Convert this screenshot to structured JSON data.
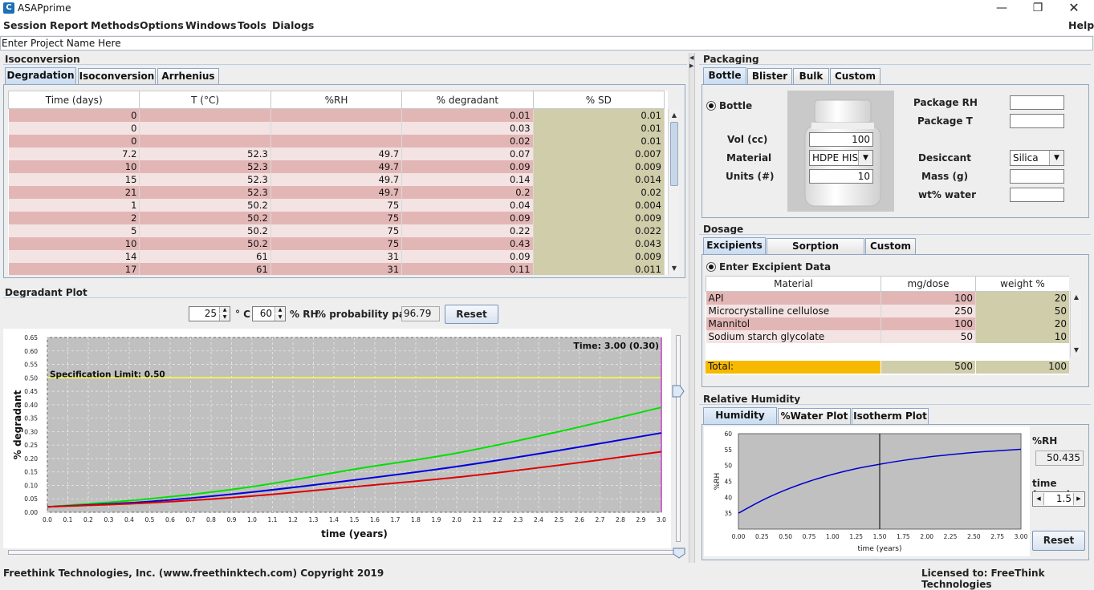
{
  "window": {
    "title": "ASAPprime",
    "icon": "app-icon"
  },
  "menu": [
    "Session",
    "Report",
    "Methods",
    "Options",
    "Windows",
    "Tools",
    "Dialogs"
  ],
  "menu_help": "Help",
  "project_name_placeholder": "Enter Project Name Here",
  "isoconversion": {
    "title": "Isoconversion",
    "tabs": [
      "Degradation",
      "Isoconversion",
      "Arrhenius"
    ],
    "columns": [
      "Time (days)",
      "T (°C)",
      "%RH",
      "% degradant",
      "% SD"
    ],
    "rows": [
      [
        "0",
        "",
        "",
        "0.01",
        "0.01"
      ],
      [
        "0",
        "",
        "",
        "0.03",
        "0.01"
      ],
      [
        "0",
        "",
        "",
        "0.02",
        "0.01"
      ],
      [
        "7.2",
        "52.3",
        "49.7",
        "0.07",
        "0.007"
      ],
      [
        "10",
        "52.3",
        "49.7",
        "0.09",
        "0.009"
      ],
      [
        "15",
        "52.3",
        "49.7",
        "0.14",
        "0.014"
      ],
      [
        "21",
        "52.3",
        "49.7",
        "0.2",
        "0.02"
      ],
      [
        "1",
        "50.2",
        "75",
        "0.04",
        "0.004"
      ],
      [
        "2",
        "50.2",
        "75",
        "0.09",
        "0.009"
      ],
      [
        "5",
        "50.2",
        "75",
        "0.22",
        "0.022"
      ],
      [
        "10",
        "50.2",
        "75",
        "0.43",
        "0.043"
      ],
      [
        "14",
        "61",
        "31",
        "0.09",
        "0.009"
      ],
      [
        "17",
        "61",
        "31",
        "0.11",
        "0.011"
      ]
    ]
  },
  "degradant_plot": {
    "title": "Degradant Plot",
    "temp_value": "25",
    "temp_unit": "° C",
    "rh_value": "60",
    "rh_unit": "% RH",
    "prob_label": "% probability pass",
    "prob_value": "96.79",
    "reset_label": "Reset"
  },
  "packaging": {
    "title": "Packaging",
    "tabs": [
      "Bottle",
      "Blister",
      "Bulk",
      "Custom"
    ],
    "radio_label": "Bottle",
    "vol_label": "Vol (cc)",
    "vol_value": "100",
    "material_label": "Material",
    "material_value": "HDPE HIS",
    "units_label": "Units (#)",
    "units_value": "10",
    "package_rh_label": "Package RH",
    "package_t_label": "Package T",
    "desiccant_label": "Desiccant",
    "desiccant_value": "Silica",
    "mass_label": "Mass (g)",
    "wt_water_label": "wt% water"
  },
  "dosage": {
    "title": "Dosage",
    "tabs": [
      "Excipients",
      "Sorption Isotherm",
      "Custom"
    ],
    "radio_label": "Enter Excipient Data",
    "columns": [
      "Material",
      "mg/dose",
      "weight %"
    ],
    "rows": [
      [
        "API",
        "100",
        "20"
      ],
      [
        "Microcrystalline cellulose",
        "250",
        "50"
      ],
      [
        "Mannitol",
        "100",
        "20"
      ],
      [
        "Sodium starch glycolate",
        "50",
        "10"
      ]
    ],
    "total_label": "Total:",
    "total_mg": "500",
    "total_pct": "100"
  },
  "relative_humidity": {
    "title": "Relative Humidity",
    "tabs": [
      "Humidity Plot",
      "%Water Plot",
      "Isotherm Plot"
    ],
    "rh_label": "%RH",
    "rh_value": "50.435",
    "time_label": "time (years)",
    "time_value": "1.5",
    "reset_label": "Reset"
  },
  "footer": {
    "left": "Freethink Technologies, Inc. (www.freethinktech.com) Copyright 2019",
    "right": "Licensed to: FreeThink Technologies"
  },
  "chart_data": [
    {
      "type": "line",
      "title": "",
      "xlabel": "time (years)",
      "ylabel": "% degradant",
      "xlim": [
        0,
        3.0
      ],
      "ylim": [
        0,
        0.65
      ],
      "x_ticks": [
        "0.0",
        "0.1",
        "0.2",
        "0.3",
        "0.4",
        "0.5",
        "0.6",
        "0.7",
        "0.8",
        "0.9",
        "1.0",
        "1.1",
        "1.2",
        "1.3",
        "1.4",
        "1.5",
        "1.6",
        "1.7",
        "1.8",
        "1.9",
        "2.0",
        "2.1",
        "2.2",
        "2.3",
        "2.4",
        "2.5",
        "2.6",
        "2.7",
        "2.8",
        "2.9",
        "3.0"
      ],
      "y_ticks": [
        "0.00",
        "0.05",
        "0.10",
        "0.15",
        "0.20",
        "0.25",
        "0.30",
        "0.35",
        "0.40",
        "0.45",
        "0.50",
        "0.55",
        "0.60",
        "0.65"
      ],
      "annotations": [
        "Time: 3.00 (0.30)",
        "Specification Limit: 0.50"
      ],
      "spec_limit": 0.5,
      "grid": true,
      "background": "#c0c0c0",
      "series": [
        {
          "color": "#00e000",
          "x": [
            0,
            0.5,
            1.0,
            1.5,
            2.0,
            2.5,
            3.0
          ],
          "y": [
            0.02,
            0.05,
            0.095,
            0.16,
            0.22,
            0.3,
            0.39
          ]
        },
        {
          "color": "#0000dd",
          "x": [
            0,
            0.5,
            1.0,
            1.5,
            2.0,
            2.5,
            3.0
          ],
          "y": [
            0.02,
            0.04,
            0.075,
            0.12,
            0.17,
            0.23,
            0.295
          ]
        },
        {
          "color": "#dd0000",
          "x": [
            0,
            0.5,
            1.0,
            1.5,
            2.0,
            2.5,
            3.0
          ],
          "y": [
            0.02,
            0.035,
            0.06,
            0.095,
            0.13,
            0.175,
            0.225
          ]
        }
      ]
    },
    {
      "type": "line",
      "title": "",
      "xlabel": "time (years)",
      "ylabel": "%RH",
      "xlim": [
        0,
        3.0
      ],
      "ylim": [
        30,
        60
      ],
      "x_ticks": [
        "0.00",
        "0.25",
        "0.50",
        "0.75",
        "1.00",
        "1.25",
        "1.50",
        "1.75",
        "2.00",
        "2.25",
        "2.50",
        "2.75",
        "3.00"
      ],
      "y_ticks": [
        "35",
        "40",
        "45",
        "50",
        "55",
        "60"
      ],
      "cursor_x": 1.5,
      "background": "#c0c0c0",
      "series": [
        {
          "color": "#0000cc",
          "x": [
            0,
            0.25,
            0.5,
            0.75,
            1.0,
            1.25,
            1.5,
            1.75,
            2.0,
            2.25,
            2.5,
            2.75,
            3.0
          ],
          "y": [
            35.0,
            39.0,
            42.3,
            45.0,
            47.2,
            49.0,
            50.4,
            51.6,
            52.6,
            53.4,
            54.1,
            54.6,
            55.1
          ]
        }
      ]
    }
  ]
}
